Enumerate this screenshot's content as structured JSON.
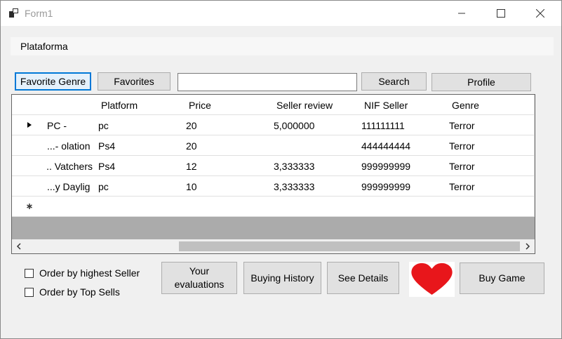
{
  "window": {
    "title": "Form1"
  },
  "menubar": {
    "items": [
      "Plataforma"
    ]
  },
  "toolbar": {
    "favorite_genre": "Favorite Genre",
    "favorites": "Favorites",
    "search_value": "",
    "search": "Search",
    "profile": "Profile"
  },
  "grid": {
    "columns": [
      "",
      "Platform",
      "Price",
      "Seller review",
      "NIF Seller",
      "Genre"
    ],
    "rows": [
      [
        "- PC",
        "pc",
        "20",
        "5,000000",
        "111111111",
        "Terror"
      ],
      [
        "olation -...",
        "Ps4",
        "20",
        "",
        "444444444",
        "Terror"
      ],
      [
        "Vatchers ...",
        "Ps4",
        "12",
        "3,333333",
        "999999999",
        "Terror"
      ],
      [
        "y Daylig...",
        "pc",
        "10",
        "3,333333",
        "999999999",
        "Terror"
      ]
    ],
    "current_row": 0
  },
  "options": {
    "order_seller": {
      "label": "Order by highest Seller",
      "checked": false
    },
    "order_sells": {
      "label": "Order by Top Sells",
      "checked": false
    }
  },
  "actions": {
    "your_evaluations": "Your\nevaluations",
    "buying_history": "Buying History",
    "see_details": "See Details",
    "buy_game": "Buy  Game"
  },
  "icons": {
    "app": "app-icon",
    "heart": "heart-icon",
    "heart_color": "#e8161b"
  }
}
